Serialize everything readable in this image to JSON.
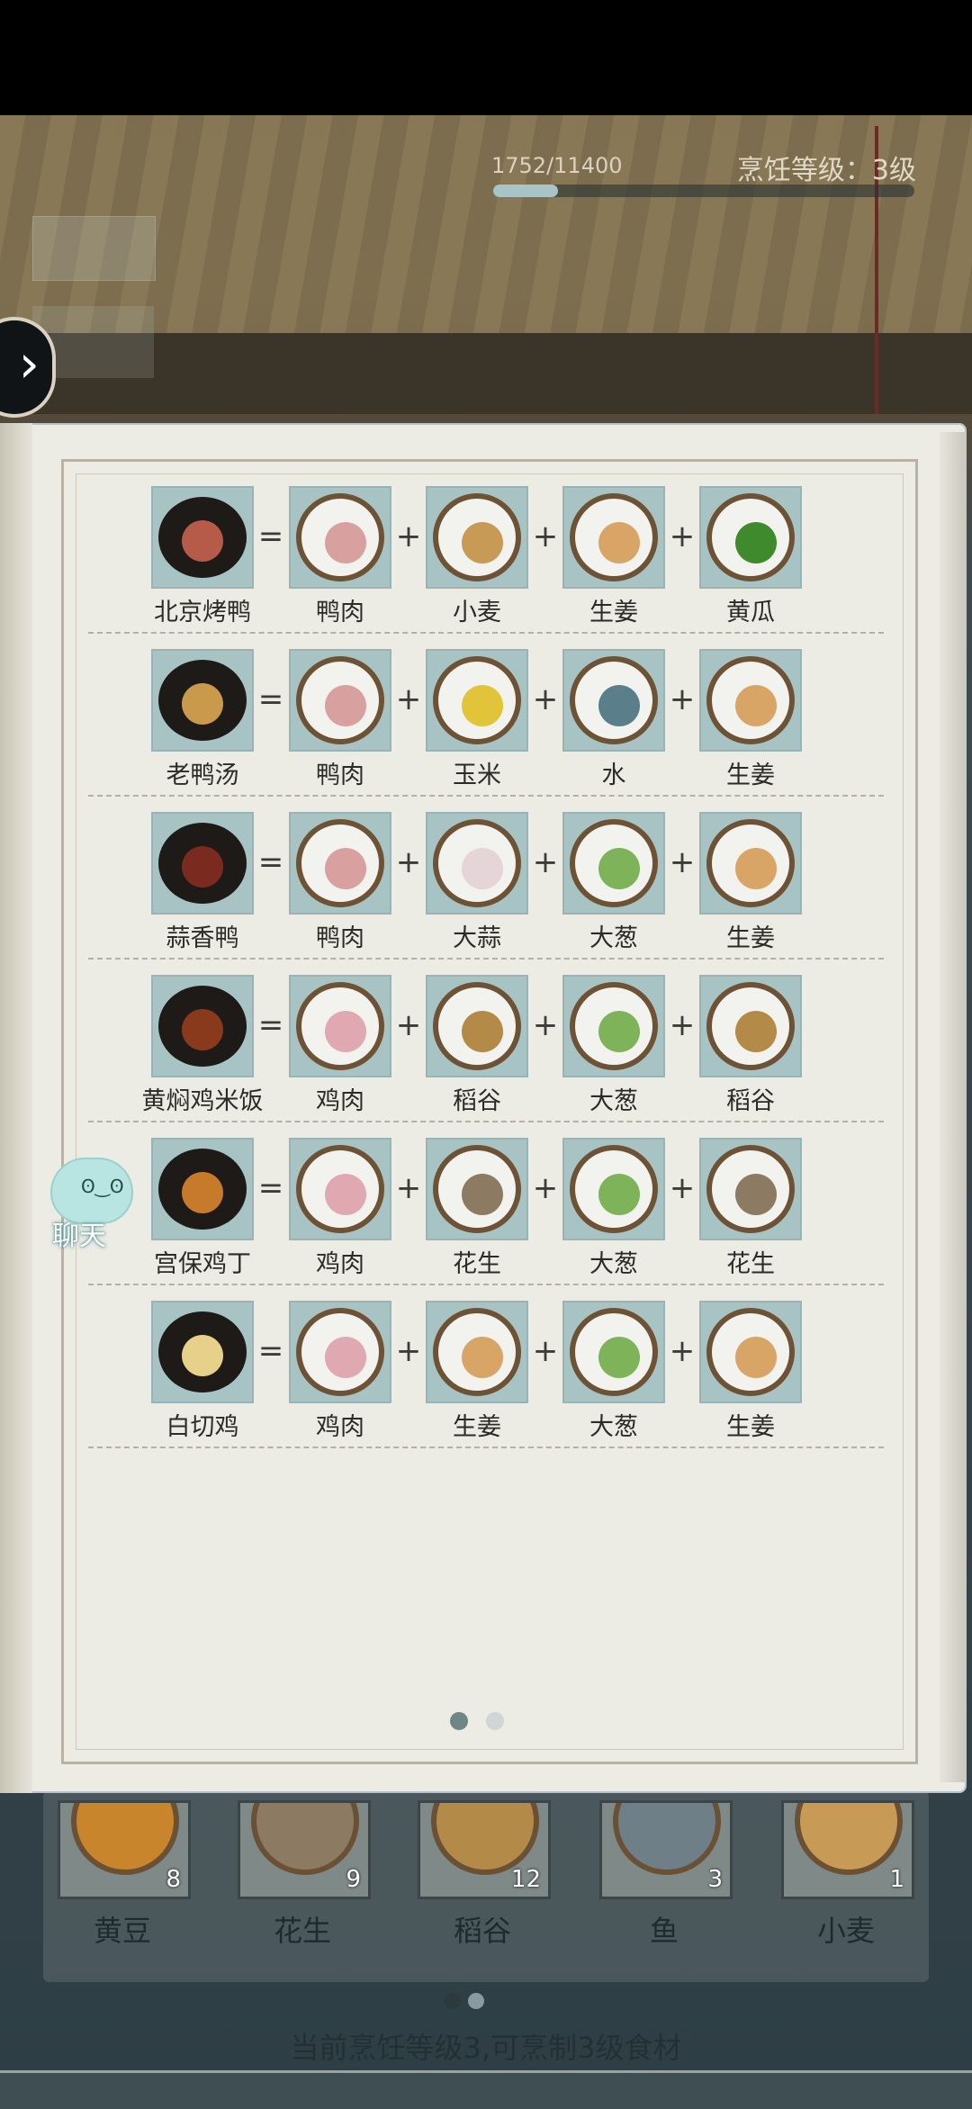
{
  "header": {
    "exp_text": "1752/11400",
    "exp_progress": 0.1537,
    "level_text": "烹饪等级：3级"
  },
  "recipes": [
    {
      "dish": "北京烤鸭",
      "ingredients": [
        "鸭肉",
        "小麦",
        "生姜",
        "黄瓜"
      ]
    },
    {
      "dish": "老鸭汤",
      "ingredients": [
        "鸭肉",
        "玉米",
        "水",
        "生姜"
      ]
    },
    {
      "dish": "蒜香鸭",
      "ingredients": [
        "鸭肉",
        "大蒜",
        "大葱",
        "生姜"
      ]
    },
    {
      "dish": "黄焖鸡米饭",
      "ingredients": [
        "鸡肉",
        "稻谷",
        "大葱",
        "稻谷"
      ]
    },
    {
      "dish": "宫保鸡丁",
      "ingredients": [
        "鸡肉",
        "花生",
        "大葱",
        "花生"
      ]
    },
    {
      "dish": "白切鸡",
      "ingredients": [
        "鸡肉",
        "生姜",
        "大葱",
        "生姜"
      ]
    }
  ],
  "operators": {
    "equals": "=",
    "plus": "+"
  },
  "chat": {
    "label": "聊天"
  },
  "inventory": [
    {
      "name": "黄豆",
      "count": "8"
    },
    {
      "name": "花生",
      "count": "9"
    },
    {
      "name": "稻谷",
      "count": "12"
    },
    {
      "name": "鱼",
      "count": "3"
    },
    {
      "name": "小麦",
      "count": "1"
    }
  ],
  "footer": {
    "text": "当前烹饪等级3,可烹制3级食材"
  },
  "book_pager": {
    "pages": 2,
    "active": 0
  },
  "inventory_pager": {
    "pages": 2,
    "active": 0
  },
  "colors": {
    "slot_bg": "#a7c3c3",
    "page_bg": "#ecebe4"
  }
}
